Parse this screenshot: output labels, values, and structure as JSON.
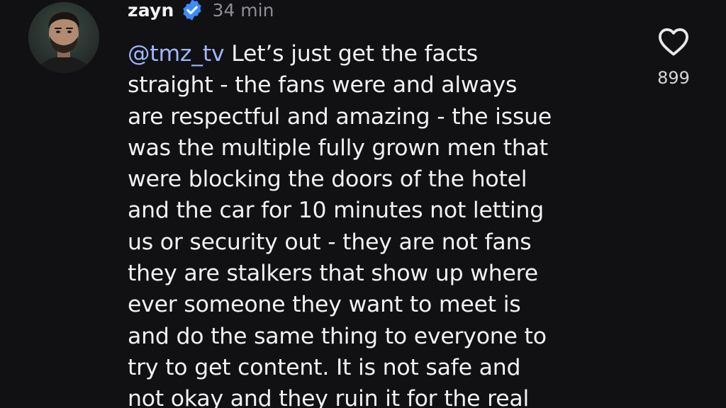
{
  "post": {
    "username": "zayn",
    "time": "34 min",
    "mention": "@tmz_tv",
    "text": " Let’s just get the facts\nstraight - the fans were and always\nare respectful and amazing - the issue\nwas the multiple fully grown men that\nwere blocking the doors of the hotel\nand the car for 10 minutes not letting\nus or security out - they are not fans\nthey are stalkers that show up where\never someone they want to meet is\nand do the same thing to everyone to\ntry to get content. It is not safe and\nnot okay and they ruin it for the real",
    "like_count": "899"
  },
  "icons": {
    "avatar": "profile-photo",
    "verified": "verified-badge-icon",
    "like": "heart-outline-icon"
  },
  "colors": {
    "background": "#111113",
    "text": "#f2f2f2",
    "muted": "#8e8e93",
    "verified": "#3d8cff"
  }
}
